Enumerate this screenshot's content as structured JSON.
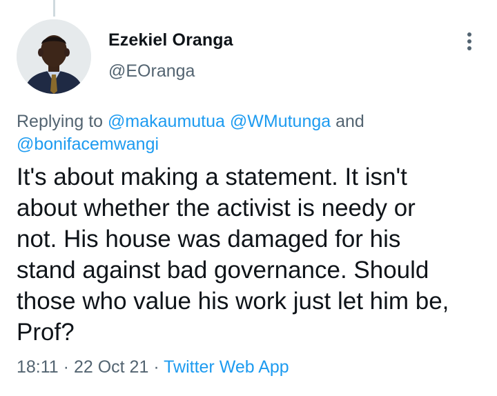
{
  "tweet": {
    "author_name": "Ezekiel Oranga",
    "author_handle": "@EOranga",
    "reply_prefix": "Replying to",
    "reply_mentions": [
      "@makaumutua",
      "@WMutunga"
    ],
    "reply_conjunction": "and",
    "reply_last_mention": "@bonifacemwangi",
    "text": "It's about making a statement. It isn't\nabout whether the activist is needy or\nnot. His house was damaged for his\nstand against bad governance. Should\nthose who value his work just let him be,\nProf?",
    "time": "18:11",
    "date": "22 Oct 21",
    "separator": "·",
    "source_app": "Twitter Web App"
  },
  "icons": {
    "more": "more-vertical-icon",
    "avatar": "profile-photo"
  },
  "colors": {
    "link": "#1d9bf0",
    "secondary_text": "#536471",
    "primary_text": "#0f1419",
    "thread_line": "#cfd9de"
  }
}
